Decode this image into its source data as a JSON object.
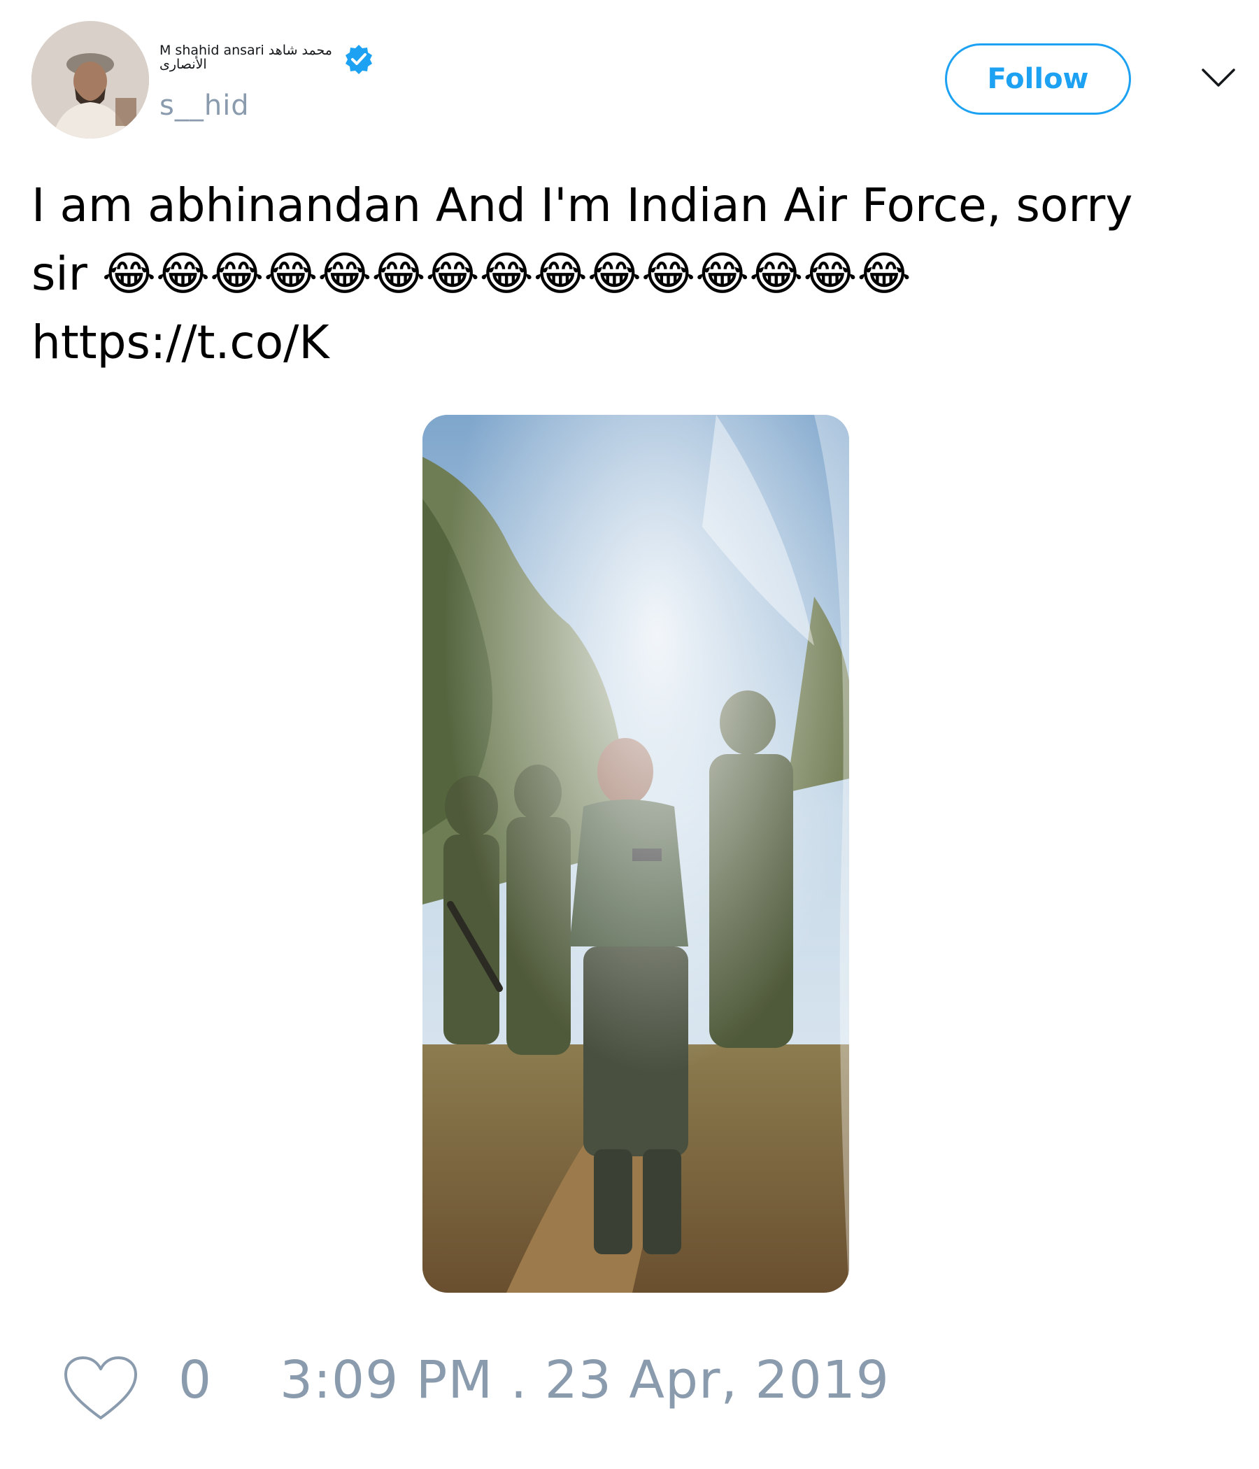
{
  "user": {
    "display_name": "M shahid ansari محمد شاهد الأنصاری",
    "handle": "s__hid",
    "verified": true
  },
  "header": {
    "follow_label": "Follow"
  },
  "tweet": {
    "text_line1": "I am abhinandan And I'm Indian Air Force, sorry",
    "text_line2": "sir 😂😂😂😂😂😂😂😂😂😂😂😂😂😂😂",
    "text_line3": "https://t.co/K"
  },
  "footer": {
    "like_count": "0",
    "timestamp": "3:09 PM . 23 Apr, 2019"
  },
  "colors": {
    "accent": "#1da1f2",
    "muted": "#8a9bae",
    "text": "#000000"
  },
  "icons": {
    "verified": "verified-badge-icon",
    "menu": "chevron-down-icon",
    "like": "heart-icon"
  }
}
